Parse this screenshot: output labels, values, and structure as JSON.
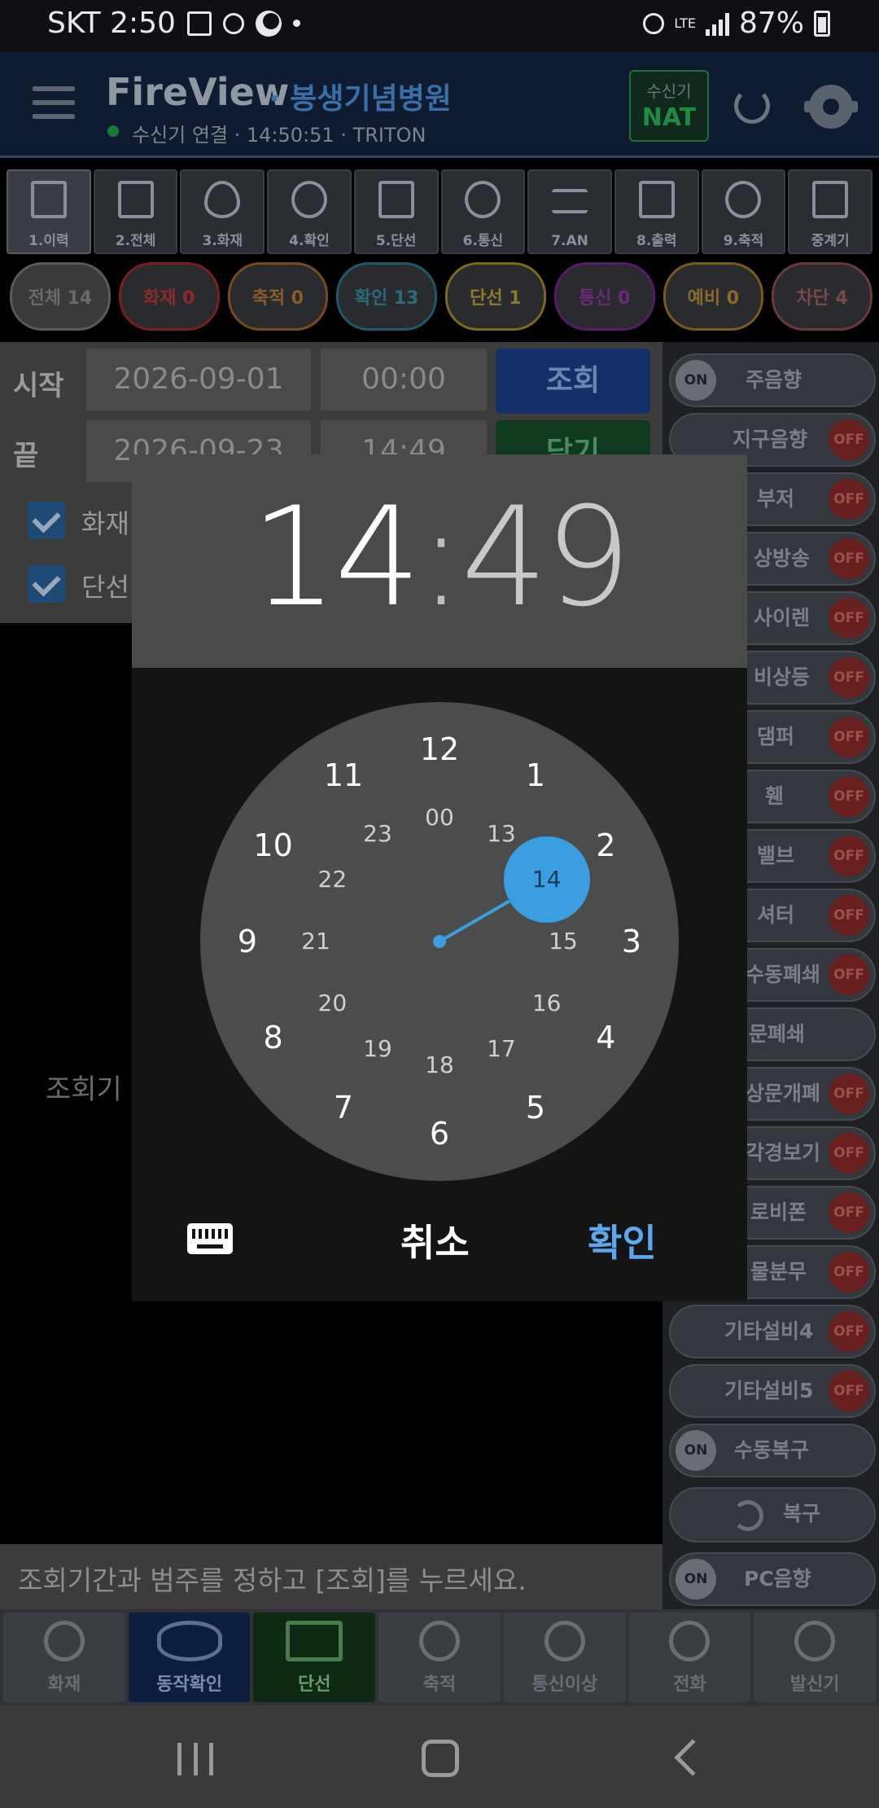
{
  "status_bar": {
    "carrier_time": "SKT 2:50",
    "network": "LTE",
    "battery": "87%"
  },
  "header": {
    "app_title": "FireView",
    "hospital": "· 봉생기념병원",
    "connection_status": "수신기 연결 · 14:50:51 · TRITON",
    "receiver_label": "수신기",
    "receiver_value": "NAT"
  },
  "toolbar": {
    "items": [
      {
        "label": "1.이력",
        "icon": "document-icon"
      },
      {
        "label": "2.전체",
        "icon": "documents-icon"
      },
      {
        "label": "3.화재",
        "icon": "flame-icon"
      },
      {
        "label": "4.확인",
        "icon": "check-search-icon"
      },
      {
        "label": "5.단선",
        "icon": "broken-line-icon"
      },
      {
        "label": "6.통신",
        "icon": "satellite-icon"
      },
      {
        "label": "7.AN",
        "icon": "wave-icon"
      },
      {
        "label": "8.출력",
        "icon": "exit-icon"
      },
      {
        "label": "9.축적",
        "icon": "timer-icon"
      },
      {
        "label": "중계기",
        "icon": "relay-icon"
      }
    ]
  },
  "chips": [
    {
      "label": "전체 14"
    },
    {
      "label": "화재 0"
    },
    {
      "label": "축적 0"
    },
    {
      "label": "확인 13"
    },
    {
      "label": "단선 1"
    },
    {
      "label": "통신 0"
    },
    {
      "label": "예비 0"
    },
    {
      "label": "차단 4"
    }
  ],
  "query": {
    "start_label": "시작",
    "start_date": "2026-09-01",
    "start_time": "00:00",
    "end_label": "끝",
    "end_date": "2026-09-23",
    "end_time": "14:49",
    "search_button": "조회",
    "close_button": "닫기",
    "check_fire": "화재",
    "check_disconnect": "단선"
  },
  "empty_text": "조회기",
  "hint": "조회기간과 범주를 정하고 [조회]를 누르세요.",
  "switches": {
    "items": [
      {
        "label": "주음향",
        "state": "ON"
      },
      {
        "label": "지구음향",
        "state": "OFF"
      },
      {
        "label": "부저",
        "state": "OFF"
      },
      {
        "label": "상방송",
        "state": "OFF"
      },
      {
        "label": "사이렌",
        "state": "OFF"
      },
      {
        "label": "비상등",
        "state": "OFF"
      },
      {
        "label": "댐퍼",
        "state": "OFF"
      },
      {
        "label": "휀",
        "state": "OFF"
      },
      {
        "label": "밸브",
        "state": "OFF"
      },
      {
        "label": "셔터",
        "state": "OFF"
      },
      {
        "label": "수동폐쇄",
        "state": "OFF"
      },
      {
        "label": "문폐쇄",
        "state": ""
      },
      {
        "label": "상문개폐",
        "state": "OFF"
      },
      {
        "label": "각경보기",
        "state": "OFF"
      },
      {
        "label": "로비폰",
        "state": "OFF"
      },
      {
        "label": "물분무",
        "state": "OFF"
      },
      {
        "label": "기타설비4",
        "state": "OFF"
      },
      {
        "label": "기타설비5",
        "state": "OFF"
      },
      {
        "label": "수동복구",
        "state": "ON"
      }
    ],
    "reset_label": "복구",
    "pc_sound_label": "PC음향",
    "pc_sound_state": "ON"
  },
  "bottom_nav": [
    {
      "label": "화재"
    },
    {
      "label": "동작확인"
    },
    {
      "label": "단선"
    },
    {
      "label": "축적"
    },
    {
      "label": "통신이상"
    },
    {
      "label": "전화"
    },
    {
      "label": "발신기"
    }
  ],
  "dialog": {
    "hour": "14",
    "colon": ":",
    "minute": "49",
    "selected_hour": 14,
    "outer_numbers": [
      "12",
      "1",
      "2",
      "3",
      "4",
      "5",
      "6",
      "7",
      "8",
      "9",
      "10",
      "11"
    ],
    "inner_numbers": [
      "00",
      "13",
      "14",
      "15",
      "16",
      "17",
      "18",
      "19",
      "20",
      "21",
      "22",
      "23"
    ],
    "cancel": "취소",
    "ok": "확인",
    "accent_color": "#3a9ee0"
  }
}
